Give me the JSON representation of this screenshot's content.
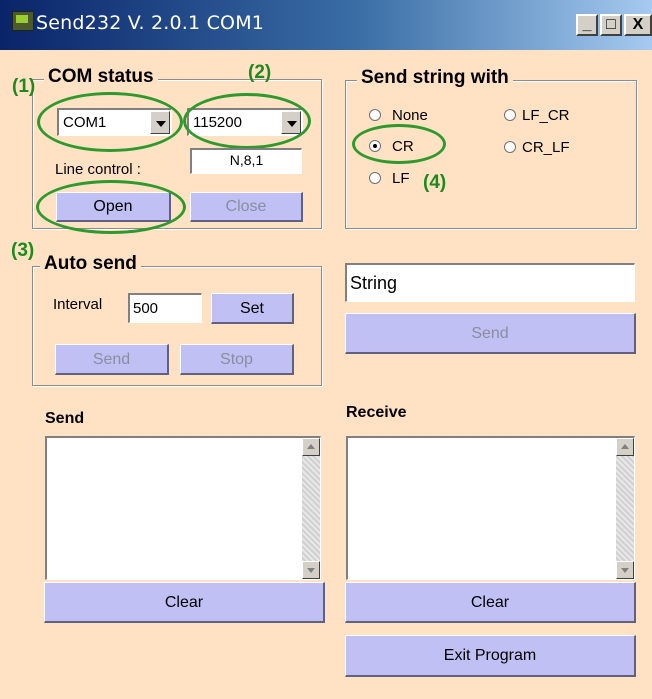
{
  "window": {
    "title": "Send232  V. 2.0.1  COM1",
    "minimize": "_",
    "maximize": "□",
    "close": "X"
  },
  "annotations": {
    "a1": "(1)",
    "a2": "(2)",
    "a3": "(3)",
    "a4": "(4)"
  },
  "com_status": {
    "title": "COM status",
    "port": "COM1",
    "baud": "115200",
    "line_control_label": "Line control :",
    "line_control_value": "N,8,1",
    "open": "Open",
    "close": "Close"
  },
  "send_with": {
    "title": "Send string with",
    "options": [
      {
        "label": "None",
        "selected": false
      },
      {
        "label": "LF_CR",
        "selected": false
      },
      {
        "label": "CR",
        "selected": true
      },
      {
        "label": "CR_LF",
        "selected": false
      },
      {
        "label": "LF",
        "selected": false
      }
    ]
  },
  "auto_send": {
    "title": "Auto send",
    "interval_label": "Interval",
    "interval_value": "500",
    "set": "Set",
    "send": "Send",
    "stop": "Stop"
  },
  "string_input": {
    "value": "String"
  },
  "string_send": "Send",
  "send_panel": {
    "title": "Send",
    "clear": "Clear"
  },
  "receive_panel": {
    "title": "Receive",
    "clear": "Clear"
  },
  "exit": "Exit Program",
  "colors": {
    "background": "#ffe1c4",
    "button": "#c0c0f4",
    "annotation": "#2e9a2e"
  }
}
